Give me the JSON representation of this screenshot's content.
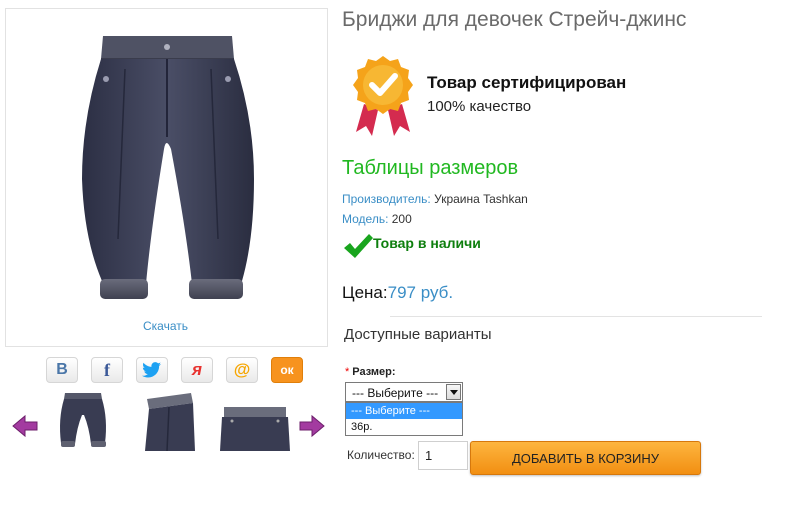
{
  "product": {
    "title": "Бриджи для девочек Стрейч-джинс",
    "download_label": "Скачать",
    "certificate": {
      "title": "Товар сертифицирован",
      "subtitle": "100% качество"
    },
    "size_table_link": "Таблицы размеров",
    "manufacturer": {
      "label": "Производитель:",
      "value": "Украина Tashkan"
    },
    "model": {
      "label": "Модель:",
      "value": "200"
    },
    "stock_status": "Товар в наличи",
    "price": {
      "label": "Цена:",
      "value": "797 руб."
    }
  },
  "share": [
    {
      "name": "vkontakte",
      "glyph": "В",
      "color": "#4a76a8"
    },
    {
      "name": "facebook",
      "glyph": "f",
      "color": "#3b5998"
    },
    {
      "name": "twitter",
      "glyph": "twitter",
      "color": "#1da1f2"
    },
    {
      "name": "moikrug",
      "glyph": "я",
      "color": "#e8322f"
    },
    {
      "name": "mailru",
      "glyph": "@",
      "color": "#f7a600"
    },
    {
      "name": "odnoklassniki",
      "glyph": "ок",
      "color": "#f7931e"
    }
  ],
  "gallery": {
    "arrow_color": "#a33ba0",
    "thumbnail_count": 3
  },
  "options": {
    "title": "Доступные варианты",
    "size": {
      "required_mark": "*",
      "label": "Размер:",
      "selected": "--- Выберите ---",
      "choices": [
        "--- Выберите ---",
        "36р."
      ]
    }
  },
  "cart": {
    "quantity_label": "Количество:",
    "quantity_value": "1",
    "add_button": "ДОБАВИТЬ В КОРЗИНУ"
  },
  "colors": {
    "link": "#3a8ec6",
    "green": "#21b821",
    "stock_green": "#0e7f0e",
    "button_orange": "#f7a228",
    "badge_gold": "#f5a31a",
    "ribbon": "#d42b4f"
  }
}
